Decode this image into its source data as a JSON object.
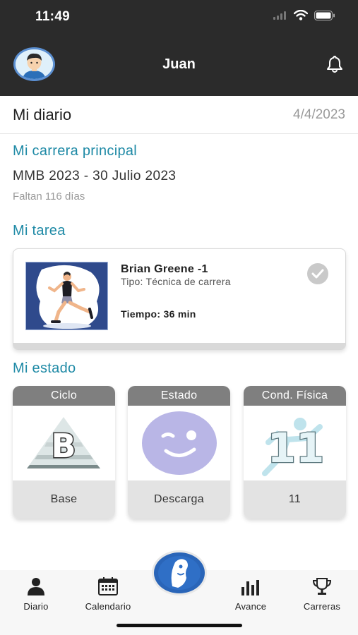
{
  "status_bar": {
    "time": "11:49"
  },
  "header": {
    "user_name": "Juan"
  },
  "diary": {
    "title": "Mi diario",
    "date": "4/4/2023"
  },
  "main_race": {
    "section_title": "Mi carrera principal",
    "name": "MMB 2023 - 30 Julio 2023",
    "remaining": "Faltan 116 días"
  },
  "task": {
    "section_title": "Mi tarea",
    "name": "Brian Greene -1",
    "type": "Tipo: Técnica de carrera",
    "time": "Tiempo: 36 min"
  },
  "state": {
    "section_title": "Mi estado",
    "cards": [
      {
        "header": "Ciclo",
        "value": "Base"
      },
      {
        "header": "Estado",
        "value": "Descarga"
      },
      {
        "header": "Cond. Física",
        "value": "11"
      }
    ]
  },
  "tabbar": {
    "items": [
      {
        "label": "Diario",
        "icon": "person-icon"
      },
      {
        "label": "Calendario",
        "icon": "calendar-icon"
      },
      {
        "label": "Avance",
        "icon": "bar-chart-icon"
      },
      {
        "label": "Carreras",
        "icon": "trophy-icon"
      }
    ]
  },
  "colors": {
    "header_bg": "#2b2b2b",
    "accent": "#1f8aa6",
    "card_header": "#7f7f7f",
    "card_footer": "#e3e3e3"
  }
}
